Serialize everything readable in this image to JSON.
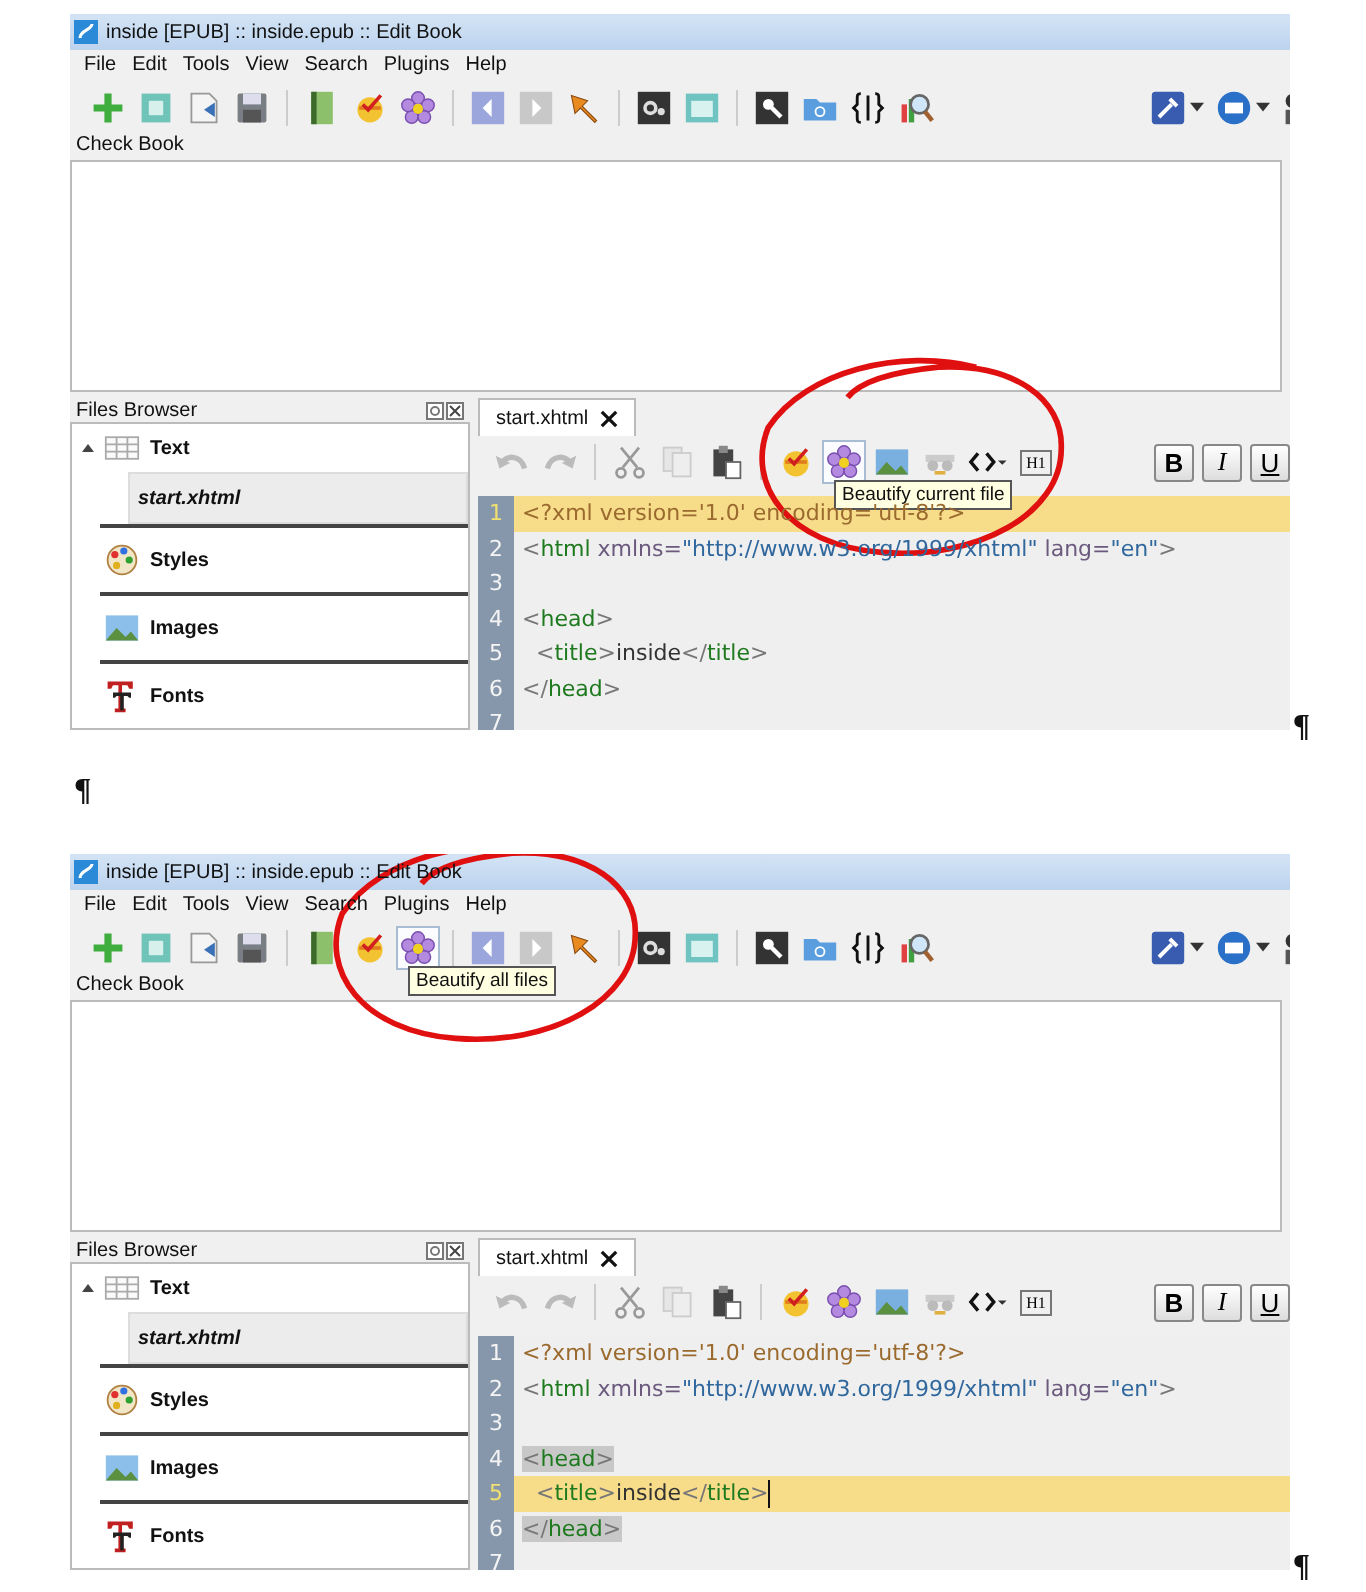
{
  "blocks": [
    {
      "kind": "screenshot",
      "title": "inside [EPUB] :: inside.epub :: Edit Book",
      "menu": [
        "File",
        "Edit",
        "Tools",
        "View",
        "Search",
        "Plugins",
        "Help"
      ],
      "main_toolbar": [
        [
          {
            "kind": "add",
            "hovered": false
          },
          {
            "kind": "new",
            "hovered": false
          },
          {
            "kind": "import",
            "hovered": false
          },
          {
            "kind": "save",
            "hovered": false
          }
        ],
        [
          {
            "kind": "book",
            "hovered": false
          },
          {
            "kind": "check",
            "hovered": false
          },
          {
            "kind": "flower",
            "hovered": false
          }
        ],
        [
          {
            "kind": "back",
            "hovered": false
          },
          {
            "kind": "forward",
            "hovered": false
          },
          {
            "kind": "pin",
            "hovered": false
          }
        ],
        [
          {
            "kind": "gear",
            "hovered": false
          },
          {
            "kind": "preview",
            "hovered": false
          }
        ],
        [
          {
            "kind": "search",
            "hovered": false
          },
          {
            "kind": "folder",
            "hovered": false
          },
          {
            "kind": "braces",
            "hovered": false
          },
          {
            "kind": "report",
            "hovered": false
          }
        ]
      ],
      "main_toolbar_right": [
        {
          "kind": "tools"
        },
        {
          "kind": "power"
        },
        {
          "kind": "figure"
        }
      ],
      "check_book_label": "Check Book",
      "files_browser": {
        "title": "Files Browser",
        "items": [
          {
            "label": "Text",
            "kind": "text",
            "expanded": true,
            "children": [
              {
                "label": "start.xhtml",
                "selected": true
              }
            ]
          },
          {
            "label": "Styles",
            "kind": "styles"
          },
          {
            "label": "Images",
            "kind": "images"
          },
          {
            "label": "Fonts",
            "kind": "fonts"
          }
        ]
      },
      "tab": "start.xhtml",
      "editor_toolbar": [
        [
          {
            "kind": "undo",
            "hovered": false
          },
          {
            "kind": "redo",
            "hovered": false
          }
        ],
        [
          {
            "kind": "cut",
            "hovered": false
          },
          {
            "kind": "copy",
            "hovered": false
          },
          {
            "kind": "paste",
            "hovered": false
          }
        ],
        [
          {
            "kind": "check",
            "hovered": false
          },
          {
            "kind": "flower",
            "hovered": true
          },
          {
            "kind": "image",
            "hovered": false
          },
          {
            "kind": "glasses",
            "hovered": false
          },
          {
            "kind": "code",
            "hovered": false
          },
          {
            "kind": "heading",
            "label": "H1",
            "hovered": false
          }
        ]
      ],
      "format_buttons": [
        "B",
        "I",
        "U"
      ],
      "tooltip": "Beautify current file",
      "circled": true,
      "code_lines": [
        {
          "number": "1",
          "current": true,
          "match": false,
          "cursor": false,
          "tokens": [
            {
              "kind": "pi",
              "text": "<?xml version='1.0' encoding='utf-8'?>"
            }
          ]
        },
        {
          "number": "2",
          "current": false,
          "match": false,
          "cursor": false,
          "tokens": [
            {
              "kind": "punct",
              "text": "<"
            },
            {
              "kind": "tag",
              "text": "html"
            },
            {
              "kind": "attr",
              "text": " xmlns="
            },
            {
              "kind": "value",
              "text": "\"http://www.w3.org/1999/xhtml\""
            },
            {
              "kind": "attr",
              "text": " lang="
            },
            {
              "kind": "value",
              "text": "\"en\""
            },
            {
              "kind": "punct",
              "text": ">"
            }
          ]
        },
        {
          "number": "3",
          "current": false,
          "match": false,
          "cursor": false
        },
        {
          "number": "4",
          "current": false,
          "match": false,
          "cursor": false,
          "tokens": [
            {
              "kind": "punct",
              "text": "<"
            },
            {
              "kind": "tag",
              "text": "head"
            },
            {
              "kind": "punct",
              "text": ">"
            }
          ]
        },
        {
          "number": "5",
          "current": false,
          "match": false,
          "cursor": false,
          "tokens": [
            {
              "kind": "punct",
              "text": "  <"
            },
            {
              "kind": "tag",
              "text": "title"
            },
            {
              "kind": "punct",
              "text": ">"
            },
            {
              "kind": "text",
              "text": "inside"
            },
            {
              "kind": "punct",
              "text": "</"
            },
            {
              "kind": "tag",
              "text": "title"
            },
            {
              "kind": "punct",
              "text": ">"
            }
          ]
        },
        {
          "number": "6",
          "current": false,
          "match": false,
          "cursor": false,
          "tokens": [
            {
              "kind": "punct",
              "text": "</"
            },
            {
              "kind": "tag",
              "text": "head"
            },
            {
              "kind": "punct",
              "text": ">"
            }
          ]
        },
        {
          "number": "7",
          "current": false,
          "match": false,
          "cursor": false
        }
      ],
      "mark": "¶"
    },
    {
      "kind": "paragraph",
      "mark": "¶"
    },
    {
      "kind": "screenshot",
      "title": "inside [EPUB] :: inside.epub :: Edit Book",
      "menu": [
        "File",
        "Edit",
        "Tools",
        "View",
        "Search",
        "Plugins",
        "Help"
      ],
      "main_toolbar": [
        [
          {
            "kind": "add",
            "hovered": false
          },
          {
            "kind": "new",
            "hovered": false
          },
          {
            "kind": "import",
            "hovered": false
          },
          {
            "kind": "save",
            "hovered": false
          }
        ],
        [
          {
            "kind": "book",
            "hovered": false
          },
          {
            "kind": "check",
            "hovered": false
          },
          {
            "kind": "flower",
            "hovered": true
          }
        ],
        [
          {
            "kind": "back",
            "hovered": false
          },
          {
            "kind": "forward",
            "hovered": false
          },
          {
            "kind": "pin",
            "hovered": false
          }
        ],
        [
          {
            "kind": "gear",
            "hovered": false
          },
          {
            "kind": "preview",
            "hovered": false
          }
        ],
        [
          {
            "kind": "search",
            "hovered": false
          },
          {
            "kind": "folder",
            "hovered": false
          },
          {
            "kind": "braces",
            "hovered": false
          },
          {
            "kind": "report",
            "hovered": false
          }
        ]
      ],
      "main_toolbar_right": [
        {
          "kind": "tools"
        },
        {
          "kind": "power"
        },
        {
          "kind": "figure"
        }
      ],
      "check_book_label": "Check Book",
      "files_browser": {
        "title": "Files Browser",
        "items": [
          {
            "label": "Text",
            "kind": "text",
            "expanded": true,
            "children": [
              {
                "label": "start.xhtml",
                "selected": true
              }
            ]
          },
          {
            "label": "Styles",
            "kind": "styles"
          },
          {
            "label": "Images",
            "kind": "images"
          },
          {
            "label": "Fonts",
            "kind": "fonts"
          }
        ]
      },
      "tab": "start.xhtml",
      "editor_toolbar": [
        [
          {
            "kind": "undo",
            "hovered": false
          },
          {
            "kind": "redo",
            "hovered": false
          }
        ],
        [
          {
            "kind": "cut",
            "hovered": false
          },
          {
            "kind": "copy",
            "hovered": false
          },
          {
            "kind": "paste",
            "hovered": false
          }
        ],
        [
          {
            "kind": "check",
            "hovered": false
          },
          {
            "kind": "flower",
            "hovered": false
          },
          {
            "kind": "image",
            "hovered": false
          },
          {
            "kind": "glasses",
            "hovered": false
          },
          {
            "kind": "code",
            "hovered": false
          },
          {
            "kind": "heading",
            "label": "H1",
            "hovered": false
          }
        ]
      ],
      "format_buttons": [
        "B",
        "I",
        "U"
      ],
      "tooltip": "Beautify all files",
      "circled": true,
      "code_lines": [
        {
          "number": "1",
          "current": false,
          "match": false,
          "cursor": false,
          "tokens": [
            {
              "kind": "pi",
              "text": "<?xml version='1.0' encoding='utf-8'?>"
            }
          ]
        },
        {
          "number": "2",
          "current": false,
          "match": false,
          "cursor": false,
          "tokens": [
            {
              "kind": "punct",
              "text": "<"
            },
            {
              "kind": "tag",
              "text": "html"
            },
            {
              "kind": "attr",
              "text": " xmlns="
            },
            {
              "kind": "value",
              "text": "\"http://www.w3.org/1999/xhtml\""
            },
            {
              "kind": "attr",
              "text": " lang="
            },
            {
              "kind": "value",
              "text": "\"en\""
            },
            {
              "kind": "punct",
              "text": ">"
            }
          ]
        },
        {
          "number": "3",
          "current": false,
          "match": false,
          "cursor": false
        },
        {
          "number": "4",
          "current": false,
          "match": true,
          "cursor": false,
          "tokens": [
            {
              "kind": "punct",
              "text": "<"
            },
            {
              "kind": "tag",
              "text": "head"
            },
            {
              "kind": "punct",
              "text": ">"
            }
          ]
        },
        {
          "number": "5",
          "current": true,
          "match": false,
          "cursor": true,
          "tokens": [
            {
              "kind": "punct",
              "text": "  <"
            },
            {
              "kind": "tag",
              "text": "title"
            },
            {
              "kind": "punct",
              "text": ">"
            },
            {
              "kind": "text",
              "text": "inside"
            },
            {
              "kind": "punct",
              "text": "</"
            },
            {
              "kind": "tag",
              "text": "title"
            },
            {
              "kind": "punct",
              "text": ">"
            }
          ]
        },
        {
          "number": "6",
          "current": false,
          "match": true,
          "cursor": false,
          "tokens": [
            {
              "kind": "punct",
              "text": "</"
            },
            {
              "kind": "tag",
              "text": "head"
            },
            {
              "kind": "punct",
              "text": ">"
            }
          ]
        },
        {
          "number": "7",
          "current": false,
          "match": false,
          "cursor": false
        }
      ],
      "mark": "¶"
    }
  ]
}
